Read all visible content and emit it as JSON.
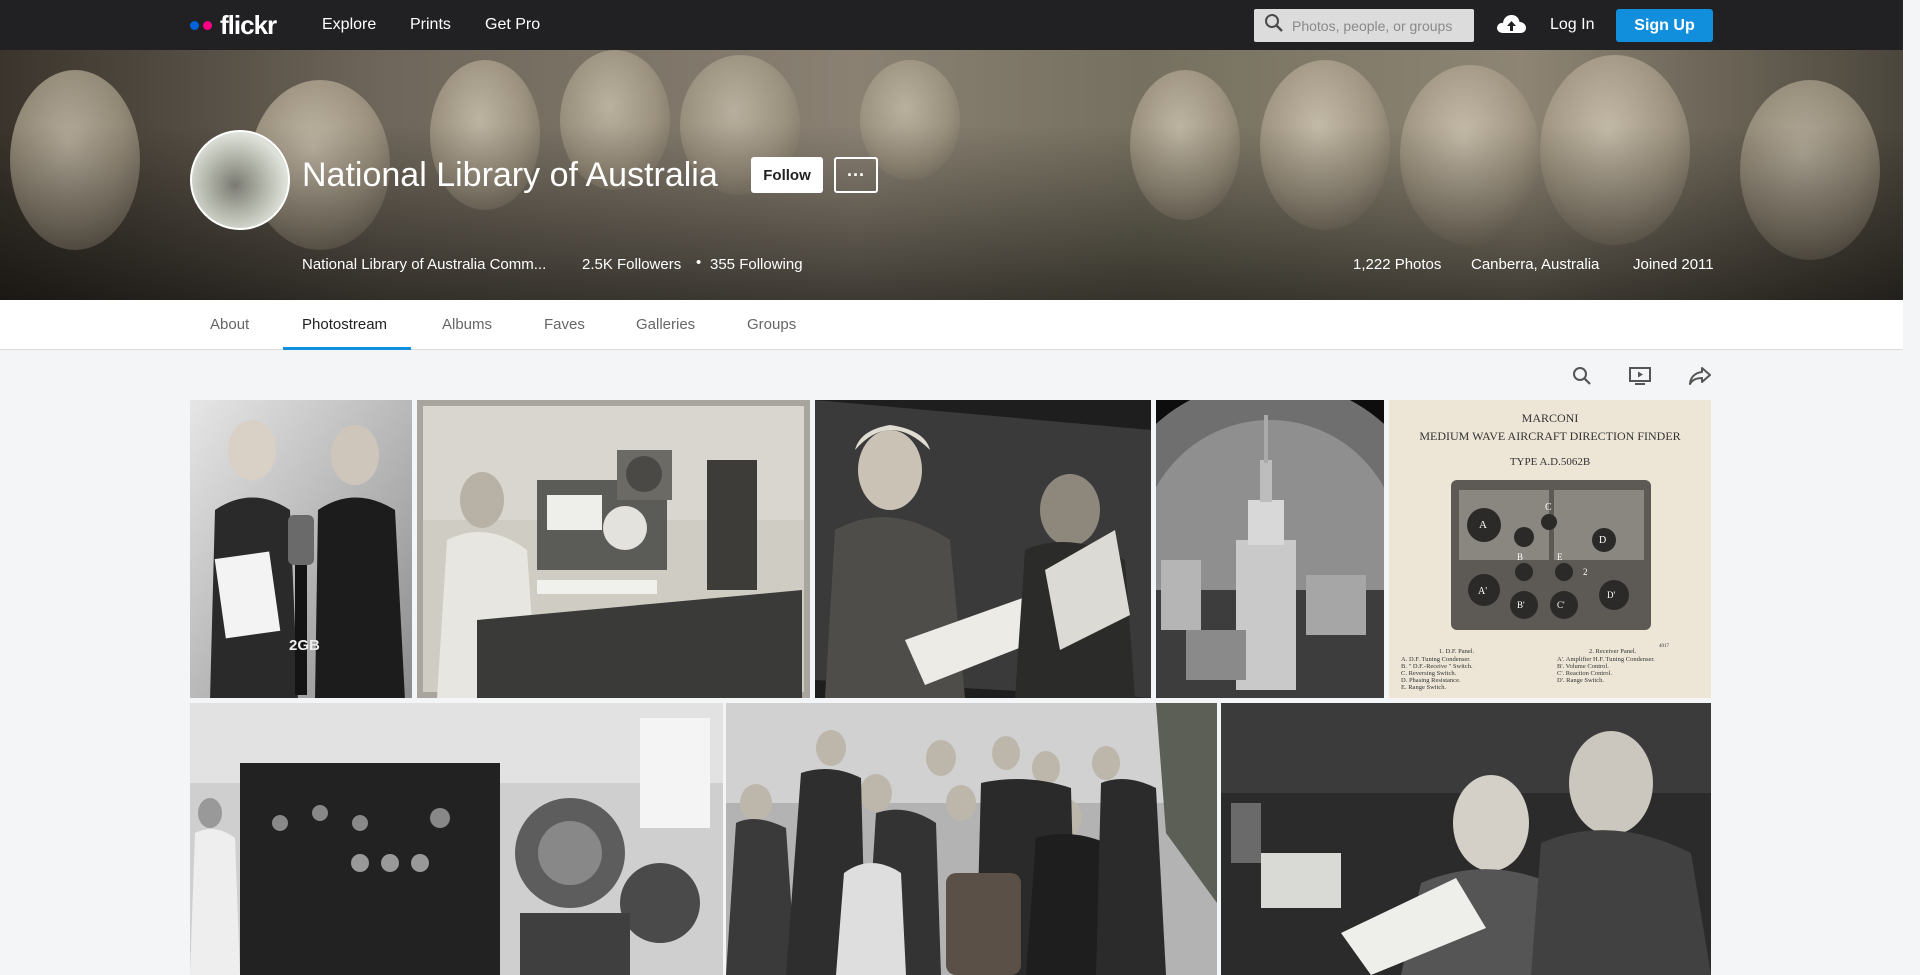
{
  "nav": {
    "logo_text": "flickr",
    "logo_colors": [
      "#0063dc",
      "#ff0084"
    ],
    "links": [
      "Explore",
      "Prints",
      "Get Pro"
    ],
    "search_placeholder": "Photos, people, or groups",
    "upload_icon": "cloud-upload-icon",
    "login_label": "Log In",
    "signup_label": "Sign Up",
    "accent_color": "#128fdc"
  },
  "profile": {
    "name": "National Library of Australia",
    "follow_label": "Follow",
    "more_label": "···",
    "subtitle": "National Library of Australia Comm...",
    "followers": "2.5K Followers",
    "separator": "•",
    "following": "355 Following",
    "photos": "1,222 Photos",
    "location": "Canberra, Australia",
    "joined": "Joined 2011"
  },
  "tabs": [
    "About",
    "Photostream",
    "Albums",
    "Faves",
    "Galleries",
    "Groups"
  ],
  "active_tab": "Photostream",
  "tools": [
    "search-icon",
    "slideshow-icon",
    "share-icon"
  ],
  "photos": [
    {
      "id": "radio-2gb-duo"
    },
    {
      "id": "office-radio-desk"
    },
    {
      "id": "woman-reading-theatre"
    },
    {
      "id": "city-tower-aerial"
    },
    {
      "id": "marconi-direction-finder",
      "caption_lines": [
        "MARCONI",
        "MEDIUM WAVE AIRCRAFT DIRECTION FINDER",
        "TYPE A.D.5062B"
      ],
      "dial_labels": [
        "A",
        "C",
        "D",
        "B",
        "E",
        "2",
        "A'",
        "B'",
        "C'",
        "D'"
      ],
      "legend_left": [
        "1. D.F. Panel.",
        "A. D.F. Tuning Condenser.",
        "B. \" D.F.-Receive \" Switch.",
        "C. Reversing Switch.",
        "D. Phasing Resistance.",
        "E. Range Switch."
      ],
      "legend_right": [
        "2. Receiver Panel.",
        "A'. Amplifier H.F. Tuning Condenser.",
        "B'. Volume Control.",
        "C'. Reaction Control.",
        "D'. Range Switch."
      ],
      "corner_number": "4017"
    },
    {
      "id": "transmitter-room"
    },
    {
      "id": "group-around-radio"
    },
    {
      "id": "two-men-reading"
    }
  ]
}
